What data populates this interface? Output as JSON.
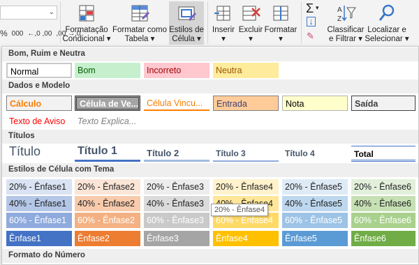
{
  "ribbon": {
    "number_format_symbols": {
      "percent": "%",
      "thousands": "000",
      "inc_decimal": "←,0 ,00",
      "dec_decimal": ",00 →,0"
    },
    "buttons": [
      {
        "label_line1": "Formatação",
        "label_line2": "Condicional ▾",
        "icon": "conditional-formatting-icon"
      },
      {
        "label_line1": "Formatar como",
        "label_line2": "Tabela ▾",
        "icon": "format-as-table-icon"
      },
      {
        "label_line1": "Estilos de",
        "label_line2": "Célula ▾",
        "icon": "cell-styles-icon"
      },
      {
        "label_line1": "Inserir",
        "label_line2": "▾",
        "icon": "insert-cells-icon"
      },
      {
        "label_line1": "Excluir",
        "label_line2": "▾",
        "icon": "delete-cells-icon"
      },
      {
        "label_line1": "Formatar",
        "label_line2": "▾",
        "icon": "format-cells-icon"
      },
      {
        "label_line1": "Classificar",
        "label_line2": "e Filtrar ▾",
        "icon": "sort-filter-icon"
      },
      {
        "label_line1": "Localizar e",
        "label_line2": "Selecionar ▾",
        "icon": "find-select-icon"
      }
    ],
    "editing_icons": {
      "sum": "Σ",
      "fill": "↓",
      "clear": "✎"
    }
  },
  "gallery": {
    "sections": [
      {
        "title": "Bom, Ruim e Neutra"
      },
      {
        "title": "Dados e Modelo"
      },
      {
        "title": "Títulos"
      },
      {
        "title": "Estilos de Célula com Tema"
      },
      {
        "title": "Formato do Número"
      }
    ],
    "good_bad_neutral": [
      "Normal",
      "Bom",
      "Incorreto",
      "Neutra"
    ],
    "data_model_row1": [
      "Cálculo",
      "Célula de Ve...",
      "Célula Vincu...",
      "Entrada",
      "Nota",
      "Saída"
    ],
    "data_model_row2": [
      "Texto de Aviso",
      "Texto Explica..."
    ],
    "titles": [
      "Título",
      "Título 1",
      "Título 2",
      "Título 3",
      "Título 4",
      "Total"
    ],
    "theme_rows": [
      [
        "20% - Ênfase1",
        "20% - Ênfase2",
        "20% - Ênfase3",
        "20% - Ênfase4",
        "20% - Ênfase5",
        "20% - Ênfase6"
      ],
      [
        "40% - Ênfase1",
        "40% - Ênfase2",
        "40% - Ênfase3",
        "40% - Ênfase4",
        "40% - Ênfase5",
        "40% - Ênfase6"
      ],
      [
        "60% - Ênfase1",
        "60% - Ênfase2",
        "60% - Ênfase3",
        "60% - Ênfase4",
        "60% - Ênfase5",
        "60% - Ênfase6"
      ],
      [
        "Ênfase1",
        "Ênfase2",
        "Ênfase3",
        "Ênfase4",
        "Ênfase5",
        "Ênfase6"
      ]
    ],
    "tooltip": "20% - Ênfase4"
  },
  "colors": {
    "good_bg": "#c6efce",
    "good_fg": "#006100",
    "bad_bg": "#ffc7ce",
    "bad_fg": "#9c0006",
    "neutral_bg": "#ffeb9c",
    "neutral_fg": "#9c5700",
    "theme20": [
      "#dae3f3",
      "#fbe5d6",
      "#ededed",
      "#fff2cc",
      "#deebf7",
      "#e2efda"
    ],
    "theme40": [
      "#b4c7e7",
      "#f8cbad",
      "#dbdbdb",
      "#ffe699",
      "#bdd7ee",
      "#c6e0b4"
    ],
    "theme60": [
      "#8faadc",
      "#f4b183",
      "#c9c9c9",
      "#ffd966",
      "#9dc3e6",
      "#a9d18e"
    ],
    "theme100": [
      "#4472c4",
      "#ed7d31",
      "#a5a5a5",
      "#ffc000",
      "#5b9bd5",
      "#70ad47"
    ]
  }
}
